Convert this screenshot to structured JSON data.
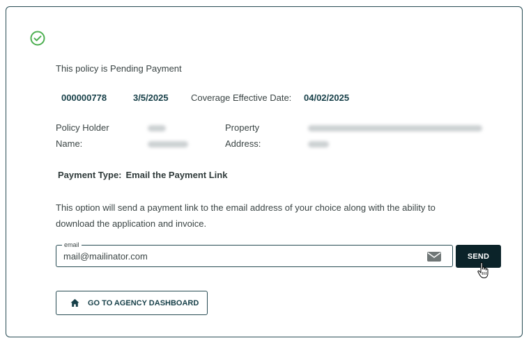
{
  "status": {
    "text": "This policy is Pending Payment"
  },
  "policy": {
    "number": "000000778",
    "date": "3/5/2025",
    "coverage_label": "Coverage Effective Date:",
    "coverage_date": "04/02/2025"
  },
  "holder": {
    "label_line1": "Policy Holder",
    "label_line2": "Name:",
    "value_hidden": true
  },
  "property": {
    "label_line1": "Property",
    "label_line2": "Address:",
    "value_hidden": true
  },
  "payment": {
    "type_label": "Payment Type:",
    "type_value": "Email the Payment Link"
  },
  "description": "This option will send a payment link to the email address of your choice along with the ability to download the application and invoice.",
  "email": {
    "legend": "email",
    "value": "mail@mailinator.com"
  },
  "buttons": {
    "send": "SEND",
    "dashboard": "GO TO AGENCY DASHBOARD"
  },
  "icons": {
    "status": "check-circle-icon",
    "email": "envelope-icon",
    "dashboard": "home-icon",
    "cursor": "hand-pointer-icon"
  },
  "colors": {
    "success": "#4caf50",
    "accent_dark": "#0b2329",
    "border": "#264a52"
  }
}
